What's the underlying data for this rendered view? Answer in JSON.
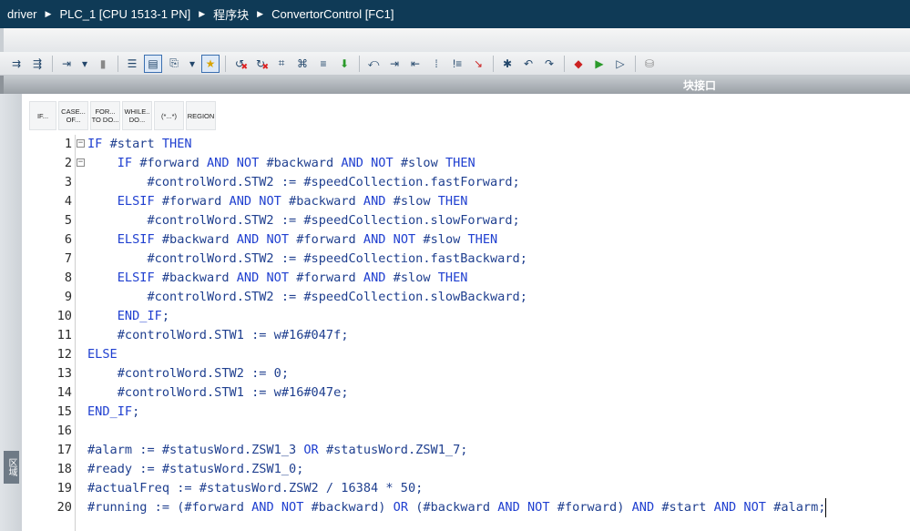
{
  "breadcrumb": [
    "driver",
    "PLC_1 [CPU 1513-1 PN]",
    "程序块",
    "ConvertorControl [FC1]"
  ],
  "block_interface_label": "块接口",
  "region_tab_label": "区域",
  "snippets": [
    {
      "label": "IF..."
    },
    {
      "label": "CASE... OF..."
    },
    {
      "label": "FOR... TO DO..."
    },
    {
      "label": "WHILE.. DO..."
    },
    {
      "label": "(*...*)"
    },
    {
      "label": "REGION"
    }
  ],
  "code_lines": [
    {
      "n": "1",
      "fold": "−",
      "text": "IF #start THEN"
    },
    {
      "n": "2",
      "fold": "−",
      "text": "    IF #forward AND NOT #backward AND NOT #slow THEN"
    },
    {
      "n": "3",
      "fold": "",
      "text": "        #controlWord.STW2 := #speedCollection.fastForward;"
    },
    {
      "n": "4",
      "fold": "",
      "text": "    ELSIF #forward AND NOT #backward AND #slow THEN"
    },
    {
      "n": "5",
      "fold": "",
      "text": "        #controlWord.STW2 := #speedCollection.slowForward;"
    },
    {
      "n": "6",
      "fold": "",
      "text": "    ELSIF #backward AND NOT #forward AND NOT #slow THEN"
    },
    {
      "n": "7",
      "fold": "",
      "text": "        #controlWord.STW2 := #speedCollection.fastBackward;"
    },
    {
      "n": "8",
      "fold": "",
      "text": "    ELSIF #backward AND NOT #forward AND #slow THEN"
    },
    {
      "n": "9",
      "fold": "",
      "text": "        #controlWord.STW2 := #speedCollection.slowBackward;"
    },
    {
      "n": "10",
      "fold": "",
      "text": "    END_IF;"
    },
    {
      "n": "11",
      "fold": "",
      "text": "    #controlWord.STW1 := w#16#047f;"
    },
    {
      "n": "12",
      "fold": "",
      "text": "ELSE"
    },
    {
      "n": "13",
      "fold": "",
      "text": "    #controlWord.STW2 := 0;"
    },
    {
      "n": "14",
      "fold": "",
      "text": "    #controlWord.STW1 := w#16#047e;"
    },
    {
      "n": "15",
      "fold": "",
      "text": "END_IF;"
    },
    {
      "n": "16",
      "fold": "",
      "text": ""
    },
    {
      "n": "17",
      "fold": "",
      "text": "#alarm := #statusWord.ZSW1_3 OR #statusWord.ZSW1_7;"
    },
    {
      "n": "18",
      "fold": "",
      "text": "#ready := #statusWord.ZSW1_0;"
    },
    {
      "n": "19",
      "fold": "",
      "text": "#actualFreq := #statusWord.ZSW2 / 16384 * 50;"
    },
    {
      "n": "20",
      "fold": "",
      "text": "#running := (#forward AND NOT #backward) OR (#backward AND NOT #forward) AND #start AND NOT #alarm;"
    }
  ],
  "colors": {
    "title_bg": "#0f3a56",
    "keyword": "#1f3fd0",
    "identifier": "#1f3f8f"
  }
}
